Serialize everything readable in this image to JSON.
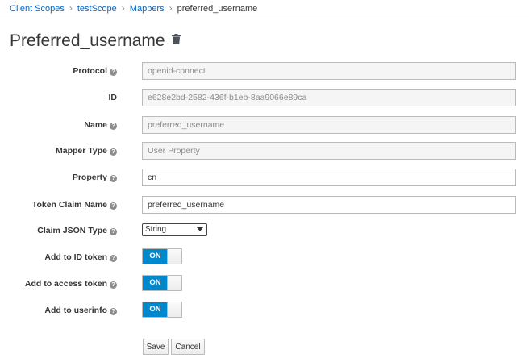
{
  "breadcrumb": {
    "items": [
      "Client Scopes",
      "testScope",
      "Mappers"
    ],
    "current": "preferred_username"
  },
  "title": "Preferred_username",
  "form": {
    "protocol": {
      "label": "Protocol",
      "value": "openid-connect"
    },
    "id": {
      "label": "ID",
      "value": "e628e2bd-2582-436f-b1eb-8aa9066e89ca"
    },
    "name": {
      "label": "Name",
      "value": "preferred_username"
    },
    "mapper_type": {
      "label": "Mapper Type",
      "value": "User Property"
    },
    "property": {
      "label": "Property",
      "value": "cn"
    },
    "token_claim_name": {
      "label": "Token Claim Name",
      "value": "preferred_username"
    },
    "claim_json_type": {
      "label": "Claim JSON Type",
      "selected": "String"
    },
    "add_to_id_token": {
      "label": "Add to ID token",
      "state": "ON"
    },
    "add_to_access_token": {
      "label": "Add to access token",
      "state": "ON"
    },
    "add_to_userinfo": {
      "label": "Add to userinfo",
      "state": "ON"
    }
  },
  "actions": {
    "save": "Save",
    "cancel": "Cancel"
  },
  "colors": {
    "link": "#0066cc",
    "toggle_on": "#0088ce"
  },
  "icons": {
    "delete": "trash-icon",
    "help": "question-circle-icon",
    "separator": "chevron-right-icon"
  }
}
